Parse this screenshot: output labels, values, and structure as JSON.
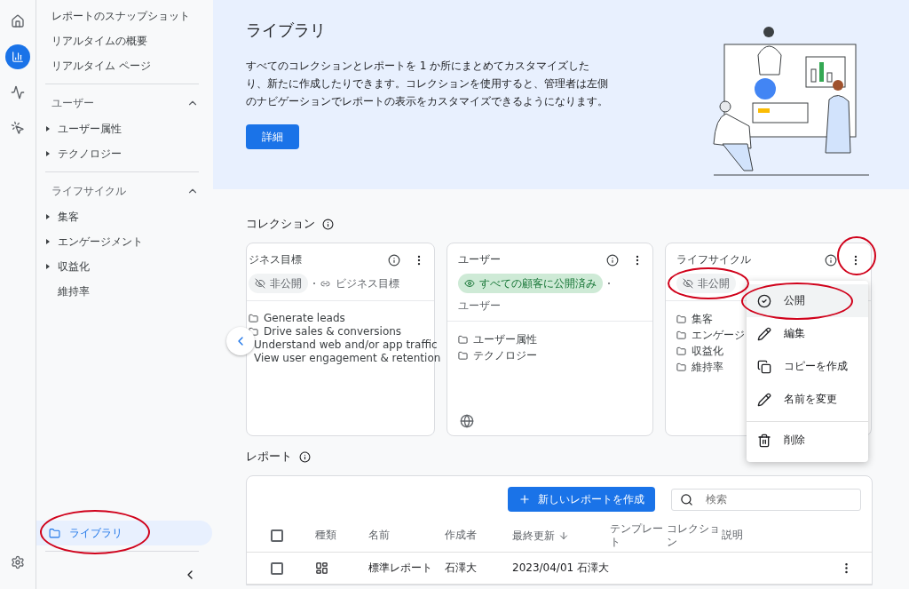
{
  "rail": {
    "items": [
      {
        "selected": false
      },
      {
        "selected": true
      },
      {
        "selected": false
      },
      {
        "selected": false
      }
    ]
  },
  "sidebar": {
    "top_items": [
      "レポートのスナップショット",
      "リアルタイムの概要",
      "リアルタイム ページ"
    ],
    "groups": [
      {
        "label": "ユーザー",
        "expanded": true,
        "children": [
          {
            "label": "ユーザー属性",
            "expandable": true
          },
          {
            "label": "テクノロジー",
            "expandable": true
          }
        ]
      },
      {
        "label": "ライフサイクル",
        "expanded": true,
        "children": [
          {
            "label": "集客",
            "expandable": true
          },
          {
            "label": "エンゲージメント",
            "expandable": true
          },
          {
            "label": "収益化",
            "expandable": true
          },
          {
            "label": "維持率",
            "expandable": false
          }
        ]
      }
    ],
    "library": {
      "label": "ライブラリ",
      "selected": true,
      "circled": true
    }
  },
  "hero": {
    "title": "ライブラリ",
    "description": "すべてのコレクションとレポートを 1 か所にまとめてカスタマイズしたり、新たに作成したりできます。コレクションを使用すると、管理者は左側のナビゲーションでレポートの表示をカスタマイズできるようになります。",
    "button": "詳細"
  },
  "collections": {
    "heading": "コレクション",
    "cards": [
      {
        "title": "ジネス目標",
        "visibility": {
          "kind": "private",
          "label": "非公開",
          "circled": false
        },
        "meta": "ビジネス目標",
        "items": [
          "Generate leads",
          "Drive sales & conversions",
          "Understand web and/or app traffic",
          "View user engagement & retention"
        ],
        "menu_circled": false,
        "footer_icon": false
      },
      {
        "title": "ユーザー",
        "visibility": {
          "kind": "public",
          "label": "すべての顧客に公開済み",
          "circled": false
        },
        "meta": "ユーザー",
        "items": [
          "ユーザー属性",
          "テクノロジー"
        ],
        "menu_circled": false,
        "footer_icon": true
      },
      {
        "title": "ライフサイクル",
        "visibility": {
          "kind": "private",
          "label": "非公開",
          "circled": true
        },
        "items": [
          "集客",
          "エンゲージ",
          "収益化",
          "維持率"
        ],
        "menu_circled": true,
        "footer_icon": false
      }
    ],
    "menu": [
      {
        "kind": "publish",
        "label": "公開",
        "highlighted": true,
        "circled": true
      },
      {
        "kind": "edit",
        "label": "編集",
        "highlighted": false,
        "circled": false
      },
      {
        "kind": "copy",
        "label": "コピーを作成",
        "highlighted": false,
        "circled": false
      },
      {
        "kind": "rename",
        "label": "名前を変更",
        "highlighted": false,
        "circled": false
      },
      {
        "kind": "delete",
        "label": "削除",
        "highlighted": false,
        "circled": false
      }
    ]
  },
  "reports": {
    "heading": "レポート",
    "create_button": "新しいレポートを作成",
    "search": {
      "placeholder": "検索"
    },
    "all_checked": false,
    "columns": [
      "種類",
      "名前",
      "作成者",
      "最終更新",
      "テンプレート",
      "コレクション",
      "説明"
    ],
    "rows": [
      {
        "checked": false,
        "name": "標準レポート",
        "creator": "石澤大",
        "updated": "2023/04/01 石澤大"
      }
    ]
  }
}
